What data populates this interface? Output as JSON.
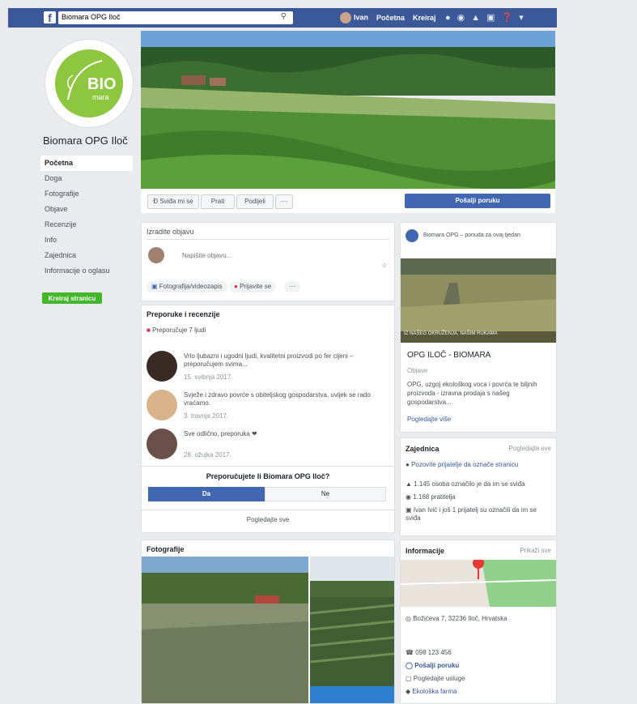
{
  "topbar": {
    "logo": "f",
    "search_value": "Biomara OPG Iloč",
    "nav": [
      "Ivan",
      "Početna",
      "Kreiraj"
    ]
  },
  "profile": {
    "logo_text": "BIO",
    "logo_sub": "mara",
    "page_name": "Biomara OPG Iloč"
  },
  "sidemenu": {
    "items": [
      "Početna",
      "Doga",
      "Fotografije",
      "Objave",
      "Recenzije",
      "Info",
      "Zajednica",
      "Informacije o oglasu"
    ],
    "create_page": "Kreiraj stranicu"
  },
  "actionbar": {
    "liked": "Đ Sviđa mi se",
    "follow": "Prati",
    "share": "Podijeli",
    "more": "···",
    "send_message": "Pošalji poruku"
  },
  "composer": {
    "title": "Izradite objavu",
    "placeholder": "Napišite objavu...",
    "photo_btn": "Fotografija/videozapis",
    "checkin_btn": "Prijavite se",
    "more": "···"
  },
  "recommendations": {
    "title": "Preporuke i recenzije",
    "subtitle": "Preporučuje 7 ljudi",
    "items": [
      {
        "text": "Vrlo ljubazni i ugodni ljudi, kvalitetni proizvodi po fer cijeni – preporučujem svima...",
        "date": "15. svibnja 2017."
      },
      {
        "text": "Svježe i zdravo povrće s obiteljskog gospodarstva, uvijek se rado vraćamo.",
        "date": "3. travnja 2017."
      },
      {
        "text": "Sve odlično, preporuka ❤",
        "date": "28. ožujka 2017."
      }
    ],
    "question": "Preporučujete li Biomara OPG Iloč?",
    "yes": "Da",
    "no": "Ne",
    "see_all": "Pogledajte sve"
  },
  "photos": {
    "title": "Fotografije"
  },
  "promo": {
    "header": "Biomara OPG – ponuda za ovaj tjedan",
    "image_caption": "IZ NAŠEG OKRUŽENJA, NAŠIM RUKAMA",
    "name": "OPG ILOČ - BIOMARA",
    "subhead": "Objave",
    "body": "OPG, uzgoj ekološkog voca i povrća te biljnih proizvoda - izravna prodaja s našeg gospodarstva...",
    "more": "Pogledajte više"
  },
  "about": {
    "title": "Zajednica",
    "see_all": "Pogledajte sve",
    "lines": [
      "Pozovite prijatelje da označe stranicu",
      "1.145 osoba označilo je da im se sviđa",
      "1.168 pratitelja",
      "Ivan Ivić i još 1 prijatelj su označili da im se sviđa"
    ]
  },
  "info": {
    "title": "Informacije",
    "see_all": "Prikaži sve",
    "address": "Božićeva 7, 32236 Iloč, Hrvatska",
    "phone": "098 123 456",
    "message": "Pošalji poruku",
    "website": "Pogledajte usluge",
    "category": "Ekološka farma"
  },
  "colors": {
    "brand": "#3b5998",
    "accent": "#4267b2",
    "green": "#42b72a",
    "logo_green": "#8dc63f"
  }
}
